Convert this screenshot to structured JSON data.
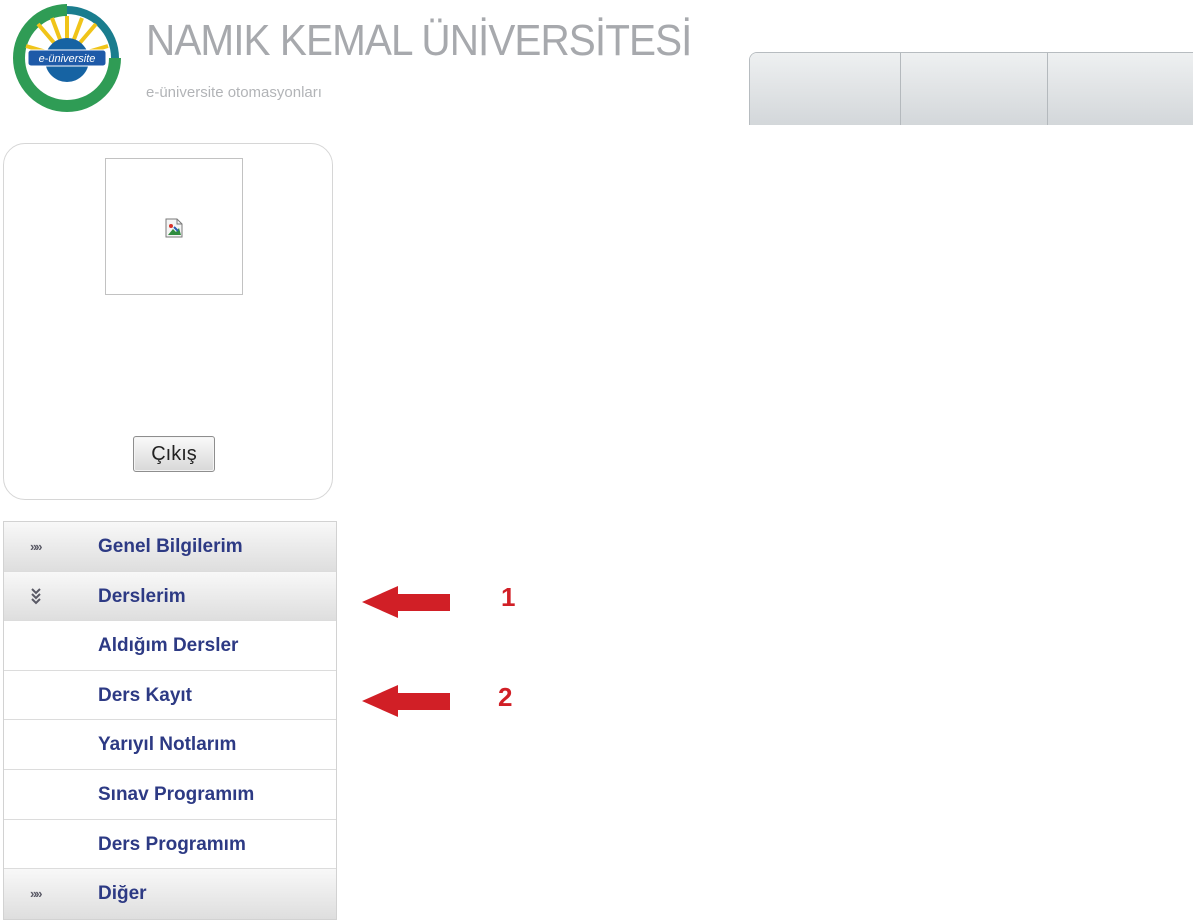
{
  "header": {
    "logo_text": "e-üniversite",
    "university_name": "NAMIK KEMAL ÜNİVERSİTESİ",
    "subtitle": "e-üniversite otomasyonları"
  },
  "profile": {
    "logout_label": "Çıkış"
  },
  "menu": {
    "items": [
      {
        "label": "Genel Bilgilerim",
        "kind": "header",
        "state": "collapsed"
      },
      {
        "label": "Derslerim",
        "kind": "header",
        "state": "expanded"
      },
      {
        "label": "Aldığım Dersler",
        "kind": "sub"
      },
      {
        "label": "Ders Kayıt",
        "kind": "sub"
      },
      {
        "label": "Yarıyıl Notlarım",
        "kind": "sub"
      },
      {
        "label": "Sınav Programım",
        "kind": "sub"
      },
      {
        "label": "Ders Programım",
        "kind": "sub"
      },
      {
        "label": "Diğer",
        "kind": "header",
        "state": "collapsed"
      }
    ],
    "collapsed_glyph": "»»"
  },
  "annotations": {
    "label_1": "1",
    "label_2": "2",
    "arrow_color": "#d11f26"
  },
  "colors": {
    "menu_text": "#2d3a84",
    "title_gray": "#a7a9ad"
  }
}
